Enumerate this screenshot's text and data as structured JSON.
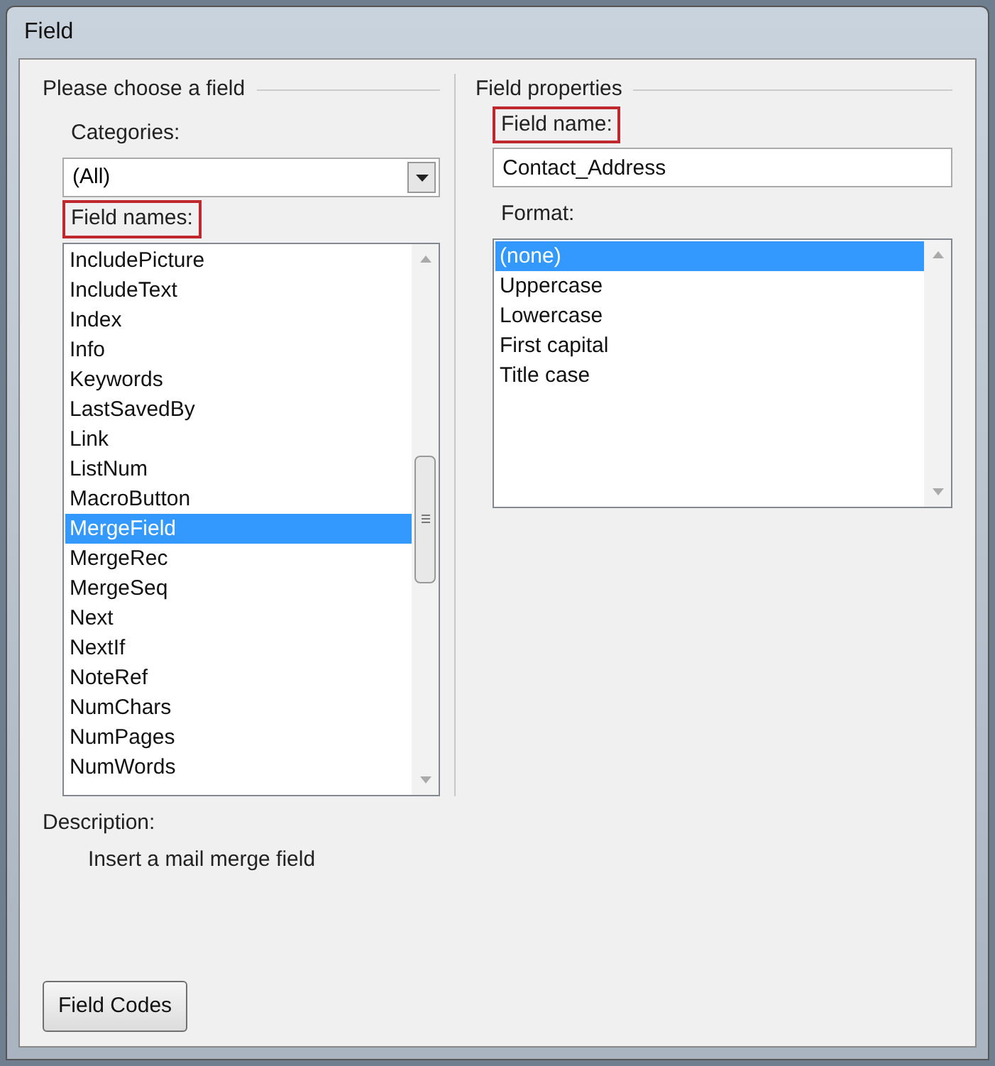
{
  "window": {
    "title": "Field"
  },
  "left": {
    "group_title": "Please choose a field",
    "categories": {
      "label": "Categories:",
      "highlighted": false,
      "value": "(All)"
    },
    "field_names": {
      "label": "Field names:",
      "highlighted": true,
      "items": [
        {
          "label": "IncludePicture",
          "selected": false
        },
        {
          "label": "IncludeText",
          "selected": false
        },
        {
          "label": "Index",
          "selected": false
        },
        {
          "label": "Info",
          "selected": false
        },
        {
          "label": "Keywords",
          "selected": false
        },
        {
          "label": "LastSavedBy",
          "selected": false
        },
        {
          "label": "Link",
          "selected": false
        },
        {
          "label": "ListNum",
          "selected": false
        },
        {
          "label": "MacroButton",
          "selected": false
        },
        {
          "label": "MergeField",
          "selected": true
        },
        {
          "label": "MergeRec",
          "selected": false
        },
        {
          "label": "MergeSeq",
          "selected": false
        },
        {
          "label": "Next",
          "selected": false
        },
        {
          "label": "NextIf",
          "selected": false
        },
        {
          "label": "NoteRef",
          "selected": false
        },
        {
          "label": "NumChars",
          "selected": false
        },
        {
          "label": "NumPages",
          "selected": false
        },
        {
          "label": "NumWords",
          "selected": false
        }
      ]
    }
  },
  "right": {
    "group_title": "Field properties",
    "field_name": {
      "label": "Field name:",
      "highlighted": true,
      "value": "Contact_Address"
    },
    "format": {
      "label": "Format:",
      "highlighted": false,
      "items": [
        {
          "label": "(none)",
          "selected": true
        },
        {
          "label": "Uppercase",
          "selected": false
        },
        {
          "label": "Lowercase",
          "selected": false
        },
        {
          "label": "First capital",
          "selected": false
        },
        {
          "label": "Title case",
          "selected": false
        }
      ]
    }
  },
  "description": {
    "label": "Description:",
    "text": "Insert a mail merge field"
  },
  "buttons": [
    {
      "label": "Field Codes"
    }
  ]
}
